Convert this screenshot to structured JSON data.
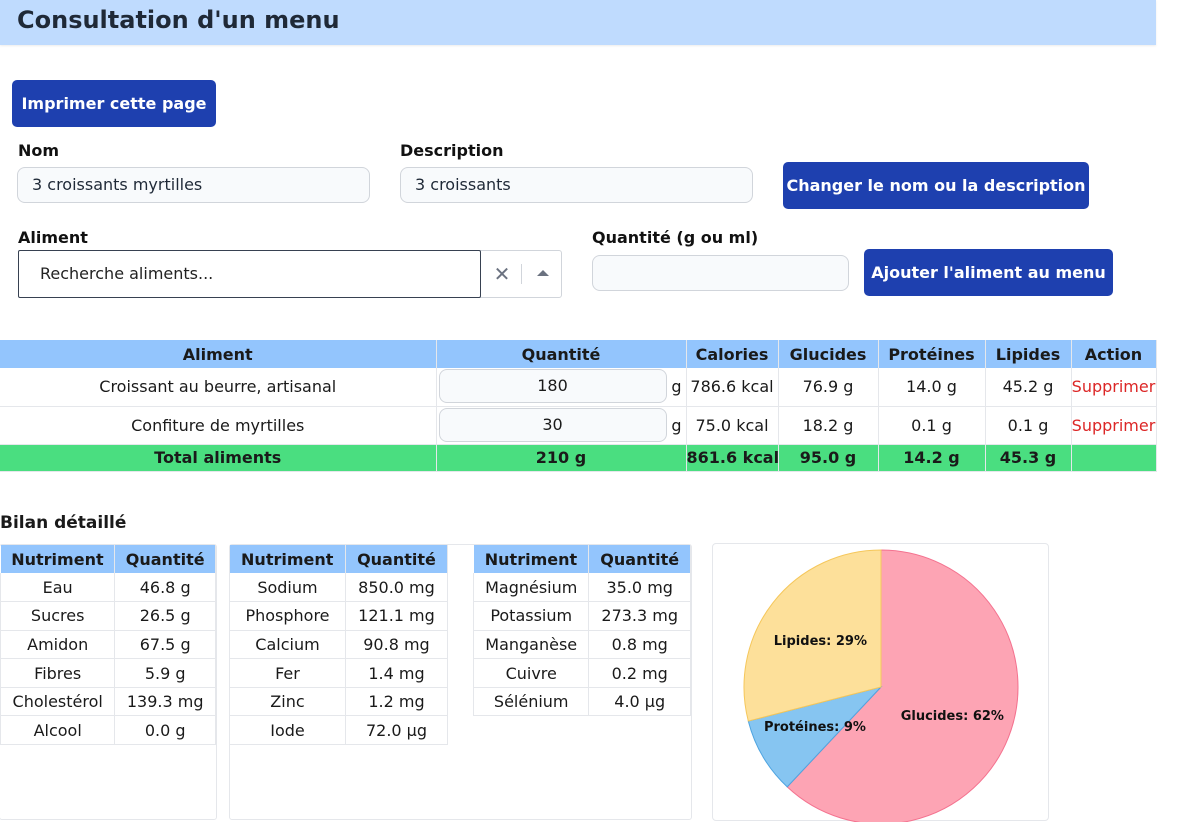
{
  "header": {
    "title": "Consultation d'un menu"
  },
  "toolbar": {
    "print_label": "Imprimer cette page"
  },
  "form": {
    "name_label": "Nom",
    "name_value": "3 croissants myrtilles",
    "description_label": "Description",
    "description_value": "3 croissants",
    "change_button": "Changer le nom ou la description",
    "food_label": "Aliment",
    "food_placeholder": "Recherche aliments...",
    "quantity_label": "Quantité (g ou ml)",
    "quantity_value": "",
    "add_button": "Ajouter l'aliment au menu"
  },
  "foods": {
    "headers": [
      "Aliment",
      "Quantité",
      "Calories",
      "Glucides",
      "Protéines",
      "Lipides",
      "Action"
    ],
    "rows": [
      {
        "name": "Croissant au beurre, artisanal",
        "quantity": "180",
        "unit": "g",
        "calories": "786.6 kcal",
        "glucides": "76.9 g",
        "proteines": "14.0 g",
        "lipides": "45.2 g",
        "action": "Supprimer"
      },
      {
        "name": "Confiture de myrtilles",
        "quantity": "30",
        "unit": "g",
        "calories": "75.0 kcal",
        "glucides": "18.2 g",
        "proteines": "0.1 g",
        "lipides": "0.1 g",
        "action": "Supprimer"
      }
    ],
    "total": {
      "label": "Total aliments",
      "quantity": "210 g",
      "calories": "861.6 kcal",
      "glucides": "95.0 g",
      "proteines": "14.2 g",
      "lipides": "45.3 g"
    }
  },
  "bilan": {
    "title": "Bilan détaillé",
    "headers": [
      "Nutriment",
      "Quantité"
    ],
    "table1": [
      [
        "Eau",
        "46.8 g"
      ],
      [
        "Sucres",
        "26.5 g"
      ],
      [
        "Amidon",
        "67.5 g"
      ],
      [
        "Fibres",
        "5.9 g"
      ],
      [
        "Cholestérol",
        "139.3 mg"
      ],
      [
        "Alcool",
        "0.0 g"
      ]
    ],
    "table2": [
      [
        "Sodium",
        "850.0 mg"
      ],
      [
        "Phosphore",
        "121.1 mg"
      ],
      [
        "Calcium",
        "90.8 mg"
      ],
      [
        "Fer",
        "1.4 mg"
      ],
      [
        "Zinc",
        "1.2 mg"
      ],
      [
        "Iode",
        "72.0 µg"
      ]
    ],
    "table3": [
      [
        "Magnésium",
        "35.0 mg"
      ],
      [
        "Potassium",
        "273.3 mg"
      ],
      [
        "Manganèse",
        "0.8 mg"
      ],
      [
        "Cuivre",
        "0.2 mg"
      ],
      [
        "Sélénium",
        "4.0 µg"
      ]
    ]
  },
  "chart_data": {
    "type": "pie",
    "slices": [
      {
        "label": "Glucides: 62%",
        "value": 62,
        "color": "#fda4b4",
        "stroke": "#f4728f"
      },
      {
        "label": "Protéines: 9%",
        "value": 9,
        "color": "#86c5f1",
        "stroke": "#4ea4e0"
      },
      {
        "label": "Lipides: 29%",
        "value": 29,
        "color": "#fde09a",
        "stroke": "#f5c75b"
      }
    ]
  },
  "colors": {
    "accent": "#1e40af",
    "header_bg": "#bfdbfe",
    "table_header": "#93c5fd",
    "total_row": "#4ade80",
    "delete_link": "#dc2626"
  },
  "icons": {
    "clear": "close-icon",
    "caret": "chevron-up-icon"
  }
}
